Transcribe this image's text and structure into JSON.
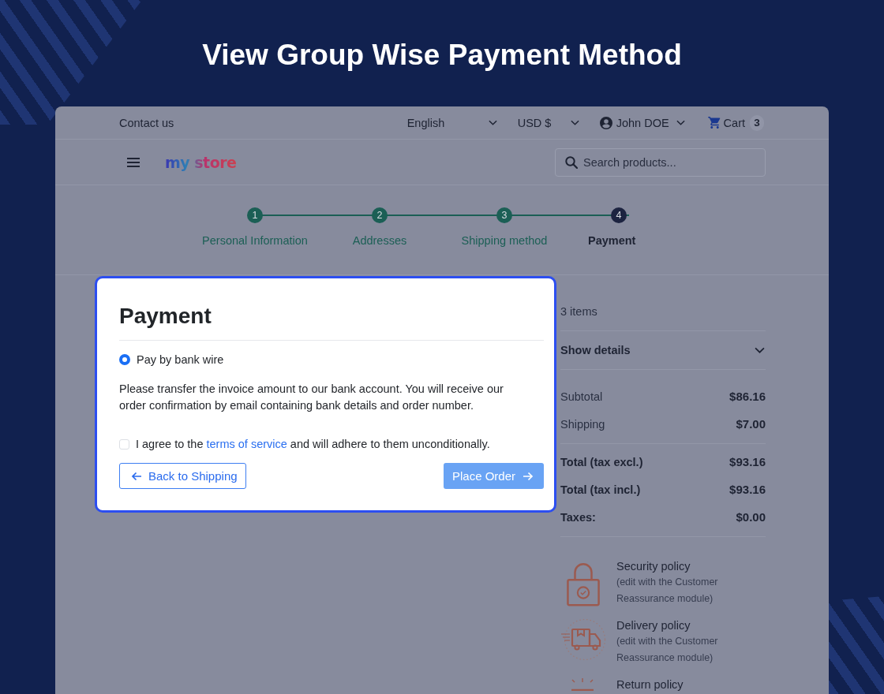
{
  "title": "View Group Wise Payment Method",
  "store": {
    "top_bar": {
      "contact": "Contact us",
      "language": "English",
      "currency": "USD $",
      "user": "John DOE",
      "cart": {
        "label": "Cart",
        "count": "3"
      }
    },
    "header": {
      "logo": "my store",
      "search": {
        "placeholder": "Search products..."
      }
    },
    "steps": [
      {
        "number": "1",
        "label": "Personal Information",
        "completed": true,
        "selected": false
      },
      {
        "number": "2",
        "label": "Addresses",
        "completed": true,
        "selected": false
      },
      {
        "number": "3",
        "label": "Shipping method",
        "completed": true,
        "selected": false
      },
      {
        "number": "4",
        "label": "Payment",
        "completed": false,
        "selected": true
      }
    ],
    "summary": {
      "items_count": "3 items",
      "details_toggle": {
        "label": "Show details",
        "expanded": false
      },
      "lines": [
        {
          "label": "Subtotal",
          "value": "$86.16"
        },
        {
          "label": "Shipping",
          "value": "$7.00"
        }
      ],
      "totals": [
        {
          "label": "Total (tax excl.)",
          "value": "$93.16"
        },
        {
          "label": "Total (tax incl.)",
          "value": "$93.16"
        },
        {
          "label": "Taxes:",
          "value": "$0.00"
        }
      ]
    },
    "policies": [
      {
        "kind": "lock",
        "title": "Security policy",
        "note": "(edit with the Customer Reassurance module)"
      },
      {
        "kind": "truck",
        "title": "Delivery policy",
        "note": "(edit with the Customer Reassurance module)"
      },
      {
        "kind": "package",
        "title": "Return policy"
      }
    ]
  },
  "payment_dialog": {
    "title": "Payment",
    "options": [
      {
        "label": "Pay by bank wire",
        "selected": true
      }
    ],
    "description": "Please transfer the invoice amount to our bank account. You will receive our order confirmation by email containing bank details and order number.",
    "terms": {
      "before": "I agree to the ",
      "link": "terms of service",
      "after": " and will adhere to them unconditionally.",
      "checked": false
    },
    "back_button": {
      "label": "Back to Shipping"
    },
    "place_order_button": {
      "label": "Place Order",
      "disabled": true
    }
  }
}
